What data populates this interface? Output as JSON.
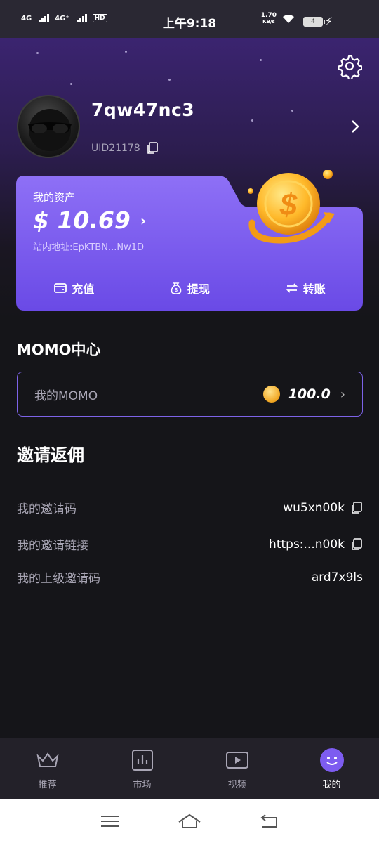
{
  "status_bar": {
    "network_1": "4G",
    "network_2": "4G⁺",
    "hd": "HD",
    "time": "上午9:18",
    "speed_value": "1.70",
    "speed_unit": "KB/s",
    "battery": "4"
  },
  "profile": {
    "username": "7qw47nc3",
    "uid": "UID21178"
  },
  "assets": {
    "label": "我的资产",
    "value": "$ 10.69",
    "address": "站内地址:EpKTBN...Nw1D",
    "actions": [
      {
        "label": "充值"
      },
      {
        "label": "提现"
      },
      {
        "label": "转账"
      }
    ]
  },
  "momo_center": {
    "title": "MOMO中心",
    "label": "我的MOMO",
    "value": "100.0"
  },
  "invite": {
    "title": "邀请返佣",
    "rows": [
      {
        "label": "我的邀请码",
        "value": "wu5xn00k"
      },
      {
        "label": "我的邀请链接",
        "value": "https:...n00k"
      },
      {
        "label": "我的上级邀请码",
        "value": "ard7x9ls"
      }
    ]
  },
  "tabs": [
    {
      "label": "推荐"
    },
    {
      "label": "市场"
    },
    {
      "label": "视频"
    },
    {
      "label": "我的"
    }
  ],
  "colors": {
    "accent": "#7d5cf0",
    "background": "#151519",
    "card_gradient_start": "#8a6cf5",
    "card_gradient_end": "#6b4be8"
  }
}
